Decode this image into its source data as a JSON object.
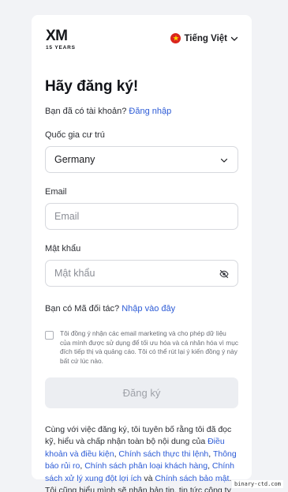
{
  "brand": {
    "logo_text": "XM",
    "logo_sub": "15 YEARS"
  },
  "language": {
    "label": "Tiếng Việt",
    "flag_icon": "vietnam-flag-icon",
    "flag_color": "#da251d"
  },
  "heading": "Hãy đăng ký!",
  "login_prompt": {
    "text": "Bạn đã có tài khoản?",
    "link": "Đăng nhập"
  },
  "country": {
    "label": "Quốc gia cư trú",
    "value": "Germany"
  },
  "email": {
    "label": "Email",
    "placeholder": "Email"
  },
  "password": {
    "label": "Mật khẩu",
    "placeholder": "Mật khẩu",
    "toggle_icon": "eye-slash-icon"
  },
  "partner": {
    "text": "Bạn có Mã đối tác?",
    "link": "Nhập vào đây"
  },
  "consent": {
    "text": "Tôi đồng ý nhận các email marketing và cho phép dữ liệu của mình được sử dụng để tối ưu hóa và cá nhân hóa vì mục đích tiếp thị và quảng cáo. Tôi có thể rút lại ý kiến đồng ý này bất cứ lúc nào.",
    "checked": false
  },
  "submit_label": "Đăng ký",
  "terms": {
    "intro": "Cùng với việc đăng ký, tôi tuyên bố rằng tôi đã đọc kỹ, hiểu và chấp nhận toàn bộ nội dung của ",
    "link1": "Điều khoản và điều kiện",
    "sep1": ", ",
    "link2": "Chính sách thực thi lệnh",
    "sep2": ", ",
    "link3": "Thông báo rủi ro",
    "sep3": ", ",
    "link4": "Chính sách phân loại khách hàng",
    "sep4": ", ",
    "link5": "Chính sách xử lý xung đột lợi ích",
    "sep5": " và ",
    "link6": "Chính sách bảo mật",
    "outro": ". Tôi cũng hiểu mình sẽ nhận bản tin, tin tức công ty và cập nhật sản phẩm."
  },
  "watermark": "binary-ctd.com",
  "colors": {
    "link": "#2c5bd6",
    "background": "#f2f3f6",
    "button_disabled": "#eceef2"
  }
}
